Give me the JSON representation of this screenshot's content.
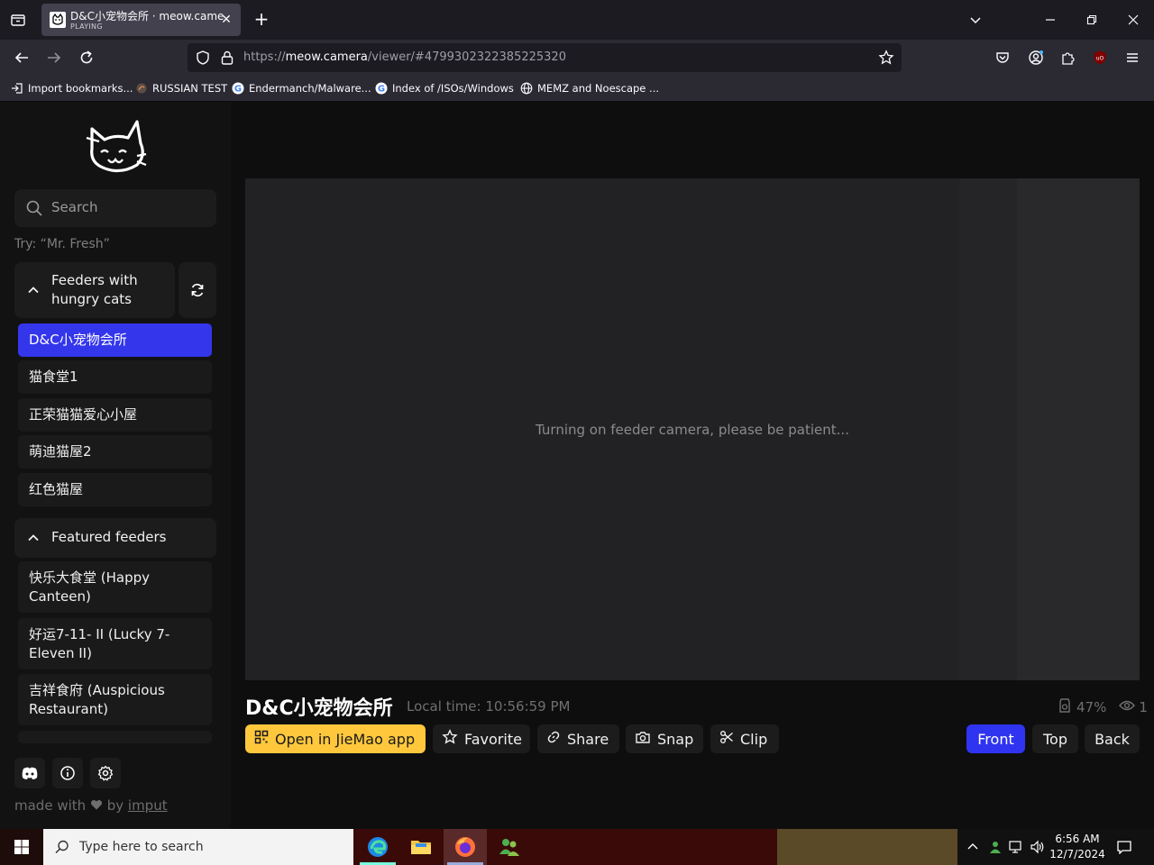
{
  "browser": {
    "tab": {
      "title": "D&C小宠物会所 · meow.camera",
      "status": "PLAYING"
    },
    "url": {
      "prefix": "https://",
      "domain": "meow.camera",
      "path": "/viewer/#4799302322385225320"
    },
    "bookmarks": [
      {
        "label": "Import bookmarks...",
        "icon": "import-icon"
      },
      {
        "label": "RUSSIAN TEST",
        "icon": "site-icon"
      },
      {
        "label": "Endermanch/Malware...",
        "icon": "google-icon"
      },
      {
        "label": "Index of /ISOs/Windows",
        "icon": "google-icon"
      },
      {
        "label": "MEMZ and Noescape ...",
        "icon": "globe-icon"
      }
    ]
  },
  "sidebar": {
    "search_placeholder": "Search",
    "try_hint": "Try: “Mr. Fresh”",
    "group1": {
      "title": "Feeders with hungry cats",
      "items": [
        "D&C小宠物会所",
        "猫食堂1",
        "正荣猫猫爱心小屋",
        "萌迪猫屋2",
        "红色猫屋"
      ]
    },
    "group2": {
      "title": "Featured feeders",
      "items": [
        "快乐大食堂 (Happy Canteen)",
        "好运7-11- II (Lucky 7-Eleven II)",
        "吉祥食府 (Auspicious Restaurant)"
      ]
    },
    "footer": {
      "made_with": "made with",
      "by": "by",
      "author": "imput"
    }
  },
  "viewer": {
    "loading_message": "Turning on feeder camera, please be patient...",
    "feeder_name": "D&C小宠物会所",
    "local_time": "Local time: 10:56:59 PM",
    "battery": "47%",
    "viewers": "1"
  },
  "actions": {
    "open_app": "Open in JieMao app",
    "favorite": "Favorite",
    "share": "Share",
    "snap": "Snap",
    "clip": "Clip",
    "front": "Front",
    "top": "Top",
    "back": "Back"
  },
  "taskbar": {
    "search_placeholder": "Type here to search",
    "time": "6:56 AM",
    "date": "12/7/2024"
  },
  "colors": {
    "accent_blue": "#3436ec",
    "accent_yellow": "#ffc83c"
  }
}
